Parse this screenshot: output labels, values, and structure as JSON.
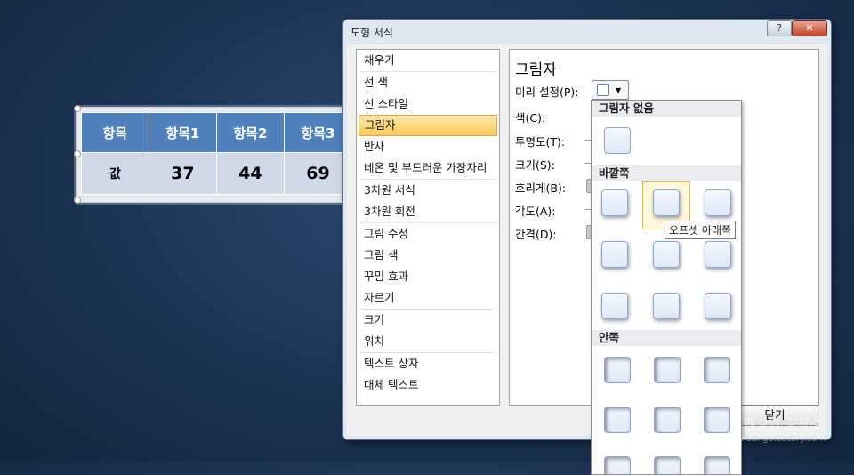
{
  "slide_table": {
    "headers": [
      "항목",
      "항목1",
      "항목2",
      "항목3"
    ],
    "values": [
      "값",
      "37",
      "44",
      "69"
    ]
  },
  "dialog": {
    "title": "도형 서식",
    "help_label": "?",
    "close_icon": "x-icon",
    "categories": [
      "채우기",
      "선 색",
      "선 스타일",
      "그림자",
      "반사",
      "네온 및 부드러운 가장자리",
      "3차원 서식",
      "3차원 회전",
      "그림 수정",
      "그림 색",
      "꾸밈 효과",
      "자르기",
      "크기",
      "위치",
      "텍스트 상자",
      "대체 텍스트"
    ],
    "selected_category": "그림자",
    "panel": {
      "title": "그림자",
      "preset_label": "미리 설정(P):",
      "color_label": "색(C):",
      "transparency_label": "투명도(T):",
      "size_label": "크기(S):",
      "blur_label": "흐리게(B):",
      "angle_label": "각도(A):",
      "distance_label": "간격(D):"
    },
    "close_button": "닫기"
  },
  "gallery": {
    "none_header": "그림자 없음",
    "outer_header": "바깥쪽",
    "inner_header": "안쪽",
    "tooltip": "오프셋 아래쪽"
  },
  "watermark": {
    "name": "펜상업 공작소",
    "url": "jeonsang0.tistory.com"
  }
}
